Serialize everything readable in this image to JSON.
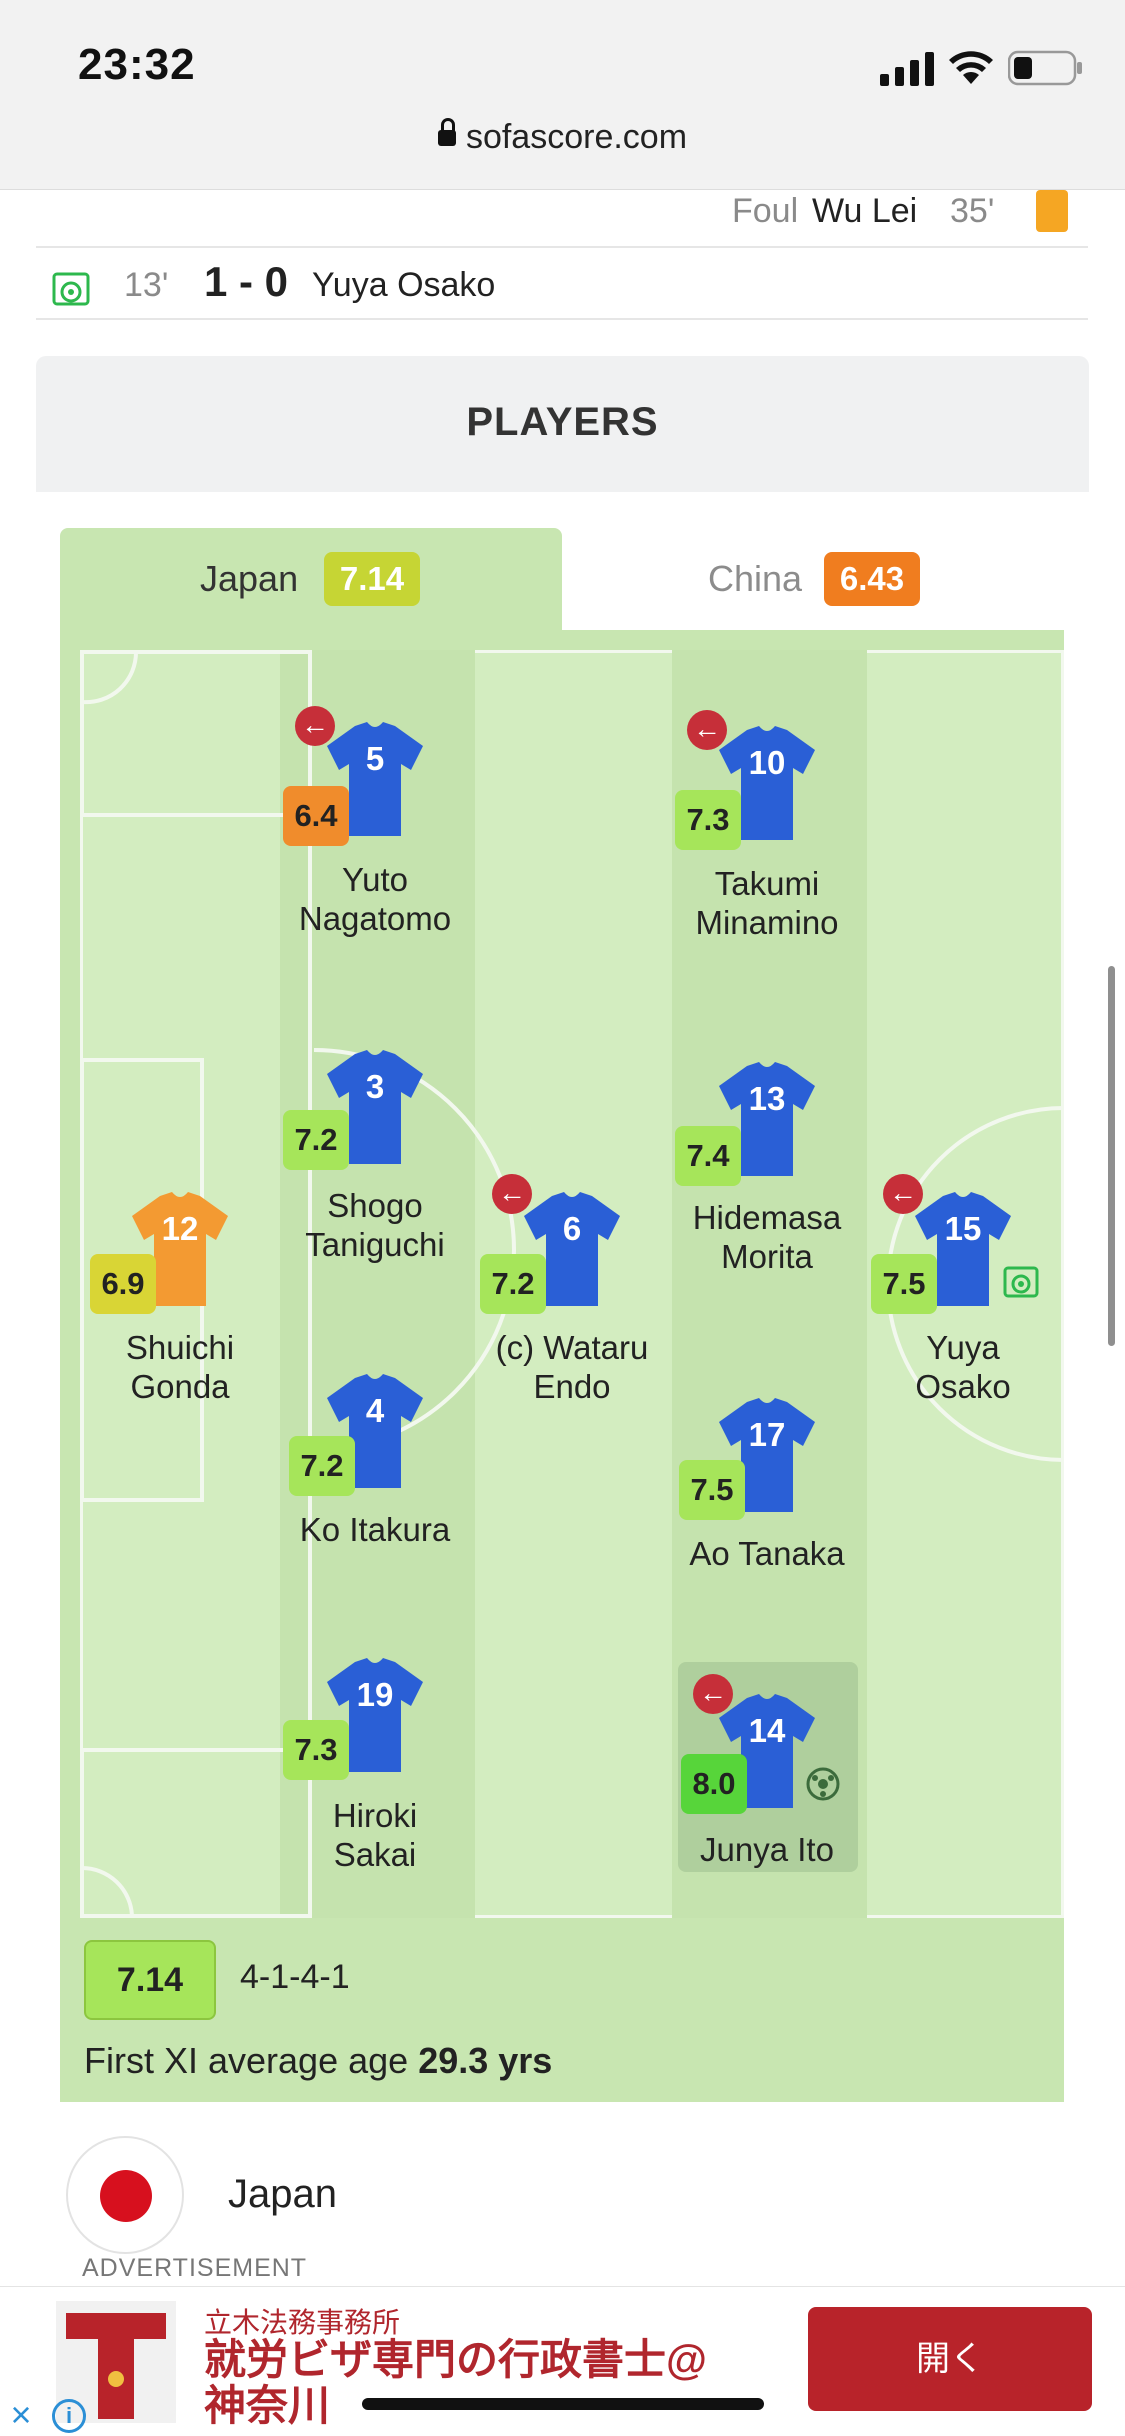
{
  "status_bar": {
    "time": "23:32"
  },
  "browser": {
    "url": "sofascore.com"
  },
  "incidents": {
    "foul": {
      "type": "Foul",
      "player": "Wu Lei",
      "minute": "35'"
    },
    "goal": {
      "minute": "13'",
      "score": "1 - 0",
      "player": "Yuya Osako"
    }
  },
  "players_header": "PLAYERS",
  "tabs": [
    {
      "team": "Japan",
      "rating": "7.14",
      "active": true
    },
    {
      "team": "China",
      "rating": "6.43",
      "active": false
    }
  ],
  "lineup": {
    "players": [
      {
        "number": "12",
        "name_lines": [
          "Shuichi",
          "Gonda"
        ],
        "rating": "6.9",
        "keeper": true
      },
      {
        "number": "5",
        "name_lines": [
          "Yuto",
          "Nagatomo"
        ],
        "rating": "6.4",
        "subbed": true
      },
      {
        "number": "3",
        "name_lines": [
          "Shogo",
          "Taniguchi"
        ],
        "rating": "7.2"
      },
      {
        "number": "4",
        "name_lines": [
          "Ko Itakura"
        ],
        "rating": "7.2"
      },
      {
        "number": "19",
        "name_lines": [
          "Hiroki",
          "Sakai"
        ],
        "rating": "7.3"
      },
      {
        "number": "6",
        "name_lines": [
          "(c) Wataru",
          "Endo"
        ],
        "rating": "7.2",
        "subbed": true
      },
      {
        "number": "10",
        "name_lines": [
          "Takumi",
          "Minamino"
        ],
        "rating": "7.3",
        "subbed": true
      },
      {
        "number": "13",
        "name_lines": [
          "Hidemasa",
          "Morita"
        ],
        "rating": "7.4"
      },
      {
        "number": "17",
        "name_lines": [
          "Ao Tanaka"
        ],
        "rating": "7.5"
      },
      {
        "number": "14",
        "name_lines": [
          "Junya Ito"
        ],
        "rating": "8.0",
        "subbed": true,
        "highlight": true,
        "goal": true
      },
      {
        "number": "15",
        "name_lines": [
          "Yuya",
          "Osako"
        ],
        "rating": "7.5",
        "subbed": true,
        "goal": true
      }
    ],
    "team_rating": "7.14",
    "formation": "4-1-4-1",
    "avg_age_label": "First XI average age",
    "avg_age_value": "29.3 yrs"
  },
  "team_row": {
    "name": "Japan"
  },
  "advertisement": {
    "label": "ADVERTISEMENT",
    "small_text": "立木法務事務所",
    "headline_line1": "就労ビザ専門の行政書士@",
    "headline_line2": "神奈川",
    "button": "開く"
  },
  "colors": {
    "rating_orange": "#f08c2c",
    "rating_yellow": "#d9d535",
    "rating_green": "#a6e55a",
    "rating_bright_green": "#57d53a",
    "shirt_blue": "#2a5fd6",
    "shirt_keeper": "#f39a32",
    "pitch": "#c8e6b1",
    "ad_red": "#b8232a"
  }
}
